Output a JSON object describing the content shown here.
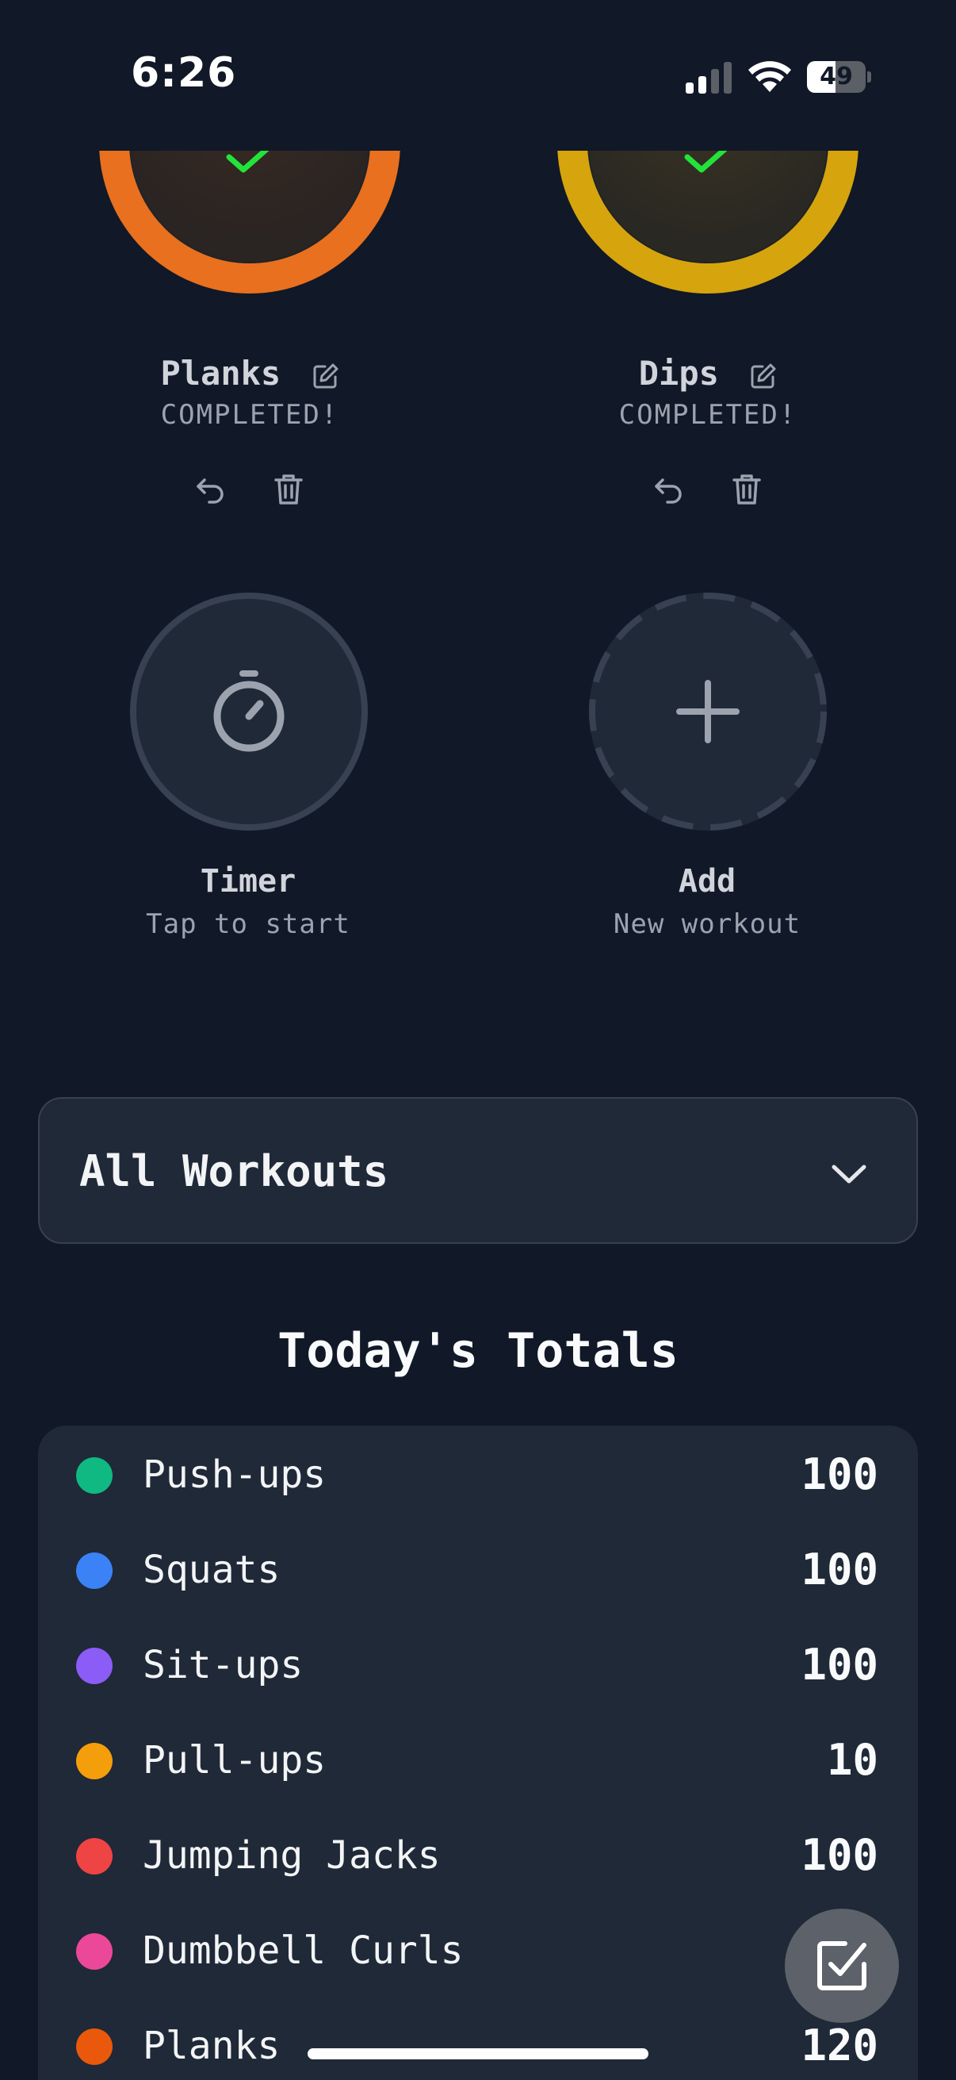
{
  "status_bar": {
    "time": "6:26",
    "battery_level": 49,
    "battery_text": "49"
  },
  "completed_cards": [
    {
      "title": "Planks",
      "status": "COMPLETED!",
      "ring_color": "#e8701e"
    },
    {
      "title": "Dips",
      "status": "COMPLETED!",
      "ring_color": "#d6a40c"
    }
  ],
  "timer": {
    "label": "Timer",
    "sublabel": "Tap to start"
  },
  "add": {
    "label": "Add",
    "sublabel": "New workout"
  },
  "filter": {
    "selected": "All Workouts"
  },
  "totals": {
    "title": "Today's Totals",
    "rows": [
      {
        "name": "Push-ups",
        "value": "100",
        "color": "#10b981"
      },
      {
        "name": "Squats",
        "value": "100",
        "color": "#3b82f6"
      },
      {
        "name": "Sit-ups",
        "value": "100",
        "color": "#8b5cf6"
      },
      {
        "name": "Pull-ups",
        "value": "10",
        "color": "#f59e0b"
      },
      {
        "name": "Jumping Jacks",
        "value": "100",
        "color": "#ef4444"
      },
      {
        "name": "Dumbbell Curls",
        "value": "",
        "color": "#ec4899"
      },
      {
        "name": "Planks",
        "value": "120",
        "color": "#ea580c"
      }
    ]
  },
  "icons": {
    "check": "checkmark-icon",
    "edit": "edit-icon",
    "undo": "undo-icon",
    "delete": "trash-icon",
    "timer": "stopwatch-icon",
    "add": "plus-icon",
    "chevron": "chevron-down-icon",
    "fab": "checkbox-icon"
  },
  "colors": {
    "background": "#111827",
    "card": "#1f2937",
    "check_green": "#22e33a"
  }
}
